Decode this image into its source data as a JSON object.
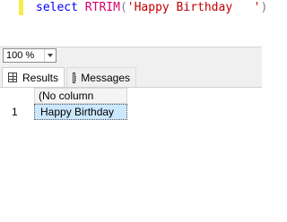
{
  "editor": {
    "tokens": {
      "keyword": "select",
      "function": "RTRIM",
      "open_paren": "(",
      "string": "'Happy Birthday   '",
      "close_paren": ")"
    }
  },
  "zoom": {
    "value": "100 %"
  },
  "tabs": [
    {
      "label": "Results",
      "icon": "grid-icon",
      "active": true
    },
    {
      "label": "Messages",
      "icon": "messages-icon",
      "active": false
    }
  ],
  "results": {
    "columns": [
      "(No column name)"
    ],
    "rows": [
      {
        "row_number": "1",
        "cells": [
          "Happy Birthday"
        ]
      }
    ]
  },
  "colors": {
    "keyword": "#0000ff",
    "function": "#d4006e",
    "string": "#c00000",
    "selected_cell": "#cce8ff"
  }
}
